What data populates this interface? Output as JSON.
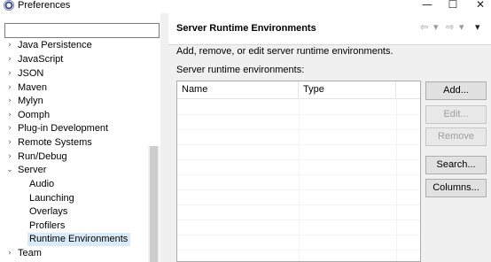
{
  "window": {
    "title": "Preferences",
    "icon": "eclipse-icon",
    "controls": {
      "minimize": "—",
      "maximize": "☐",
      "close": "✕"
    }
  },
  "sidebar": {
    "filter_placeholder": "",
    "items": [
      {
        "label": "Java Persistence",
        "expanded": false,
        "level": 0
      },
      {
        "label": "JavaScript",
        "expanded": false,
        "level": 0
      },
      {
        "label": "JSON",
        "expanded": false,
        "level": 0
      },
      {
        "label": "Maven",
        "expanded": false,
        "level": 0
      },
      {
        "label": "Mylyn",
        "expanded": false,
        "level": 0
      },
      {
        "label": "Oomph",
        "expanded": false,
        "level": 0
      },
      {
        "label": "Plug-in Development",
        "expanded": false,
        "level": 0
      },
      {
        "label": "Remote Systems",
        "expanded": false,
        "level": 0
      },
      {
        "label": "Run/Debug",
        "expanded": false,
        "level": 0
      },
      {
        "label": "Server",
        "expanded": true,
        "level": 0
      },
      {
        "label": "Audio",
        "level": 1
      },
      {
        "label": "Launching",
        "level": 1
      },
      {
        "label": "Overlays",
        "level": 1
      },
      {
        "label": "Profilers",
        "level": 1
      },
      {
        "label": "Runtime Environments",
        "level": 1,
        "selected": true
      },
      {
        "label": "Team",
        "expanded": false,
        "level": 0
      }
    ]
  },
  "page": {
    "title": "Server Runtime Environments",
    "description": "Add, remove, or edit server runtime environments.",
    "list_label": "Server runtime environments:",
    "nav": {
      "back": "⇦",
      "back_menu": "▾",
      "forward": "⇨",
      "forward_menu": "▾",
      "view_menu": "▾"
    },
    "table": {
      "columns": [
        "Name",
        "Type"
      ],
      "rows": []
    },
    "buttons": {
      "add": "Add...",
      "edit": "Edit...",
      "remove": "Remove",
      "search": "Search...",
      "columns": "Columns..."
    }
  }
}
